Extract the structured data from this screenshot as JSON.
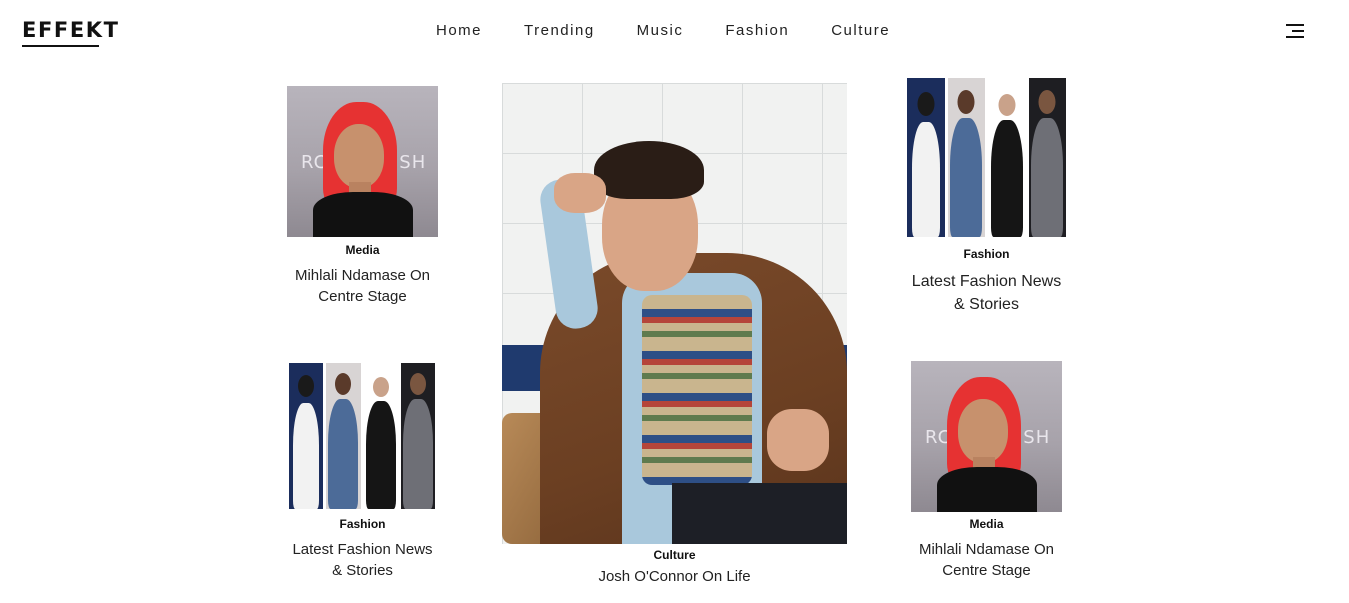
{
  "brand": {
    "logo": "EFFEKT"
  },
  "nav": {
    "items": [
      {
        "label": "Home"
      },
      {
        "label": "Trending"
      },
      {
        "label": "Music"
      },
      {
        "label": "Fashion"
      },
      {
        "label": "Culture"
      }
    ],
    "menu_icon": "hamburger-menu-icon"
  },
  "cards": {
    "left_top": {
      "category": "Media",
      "title_line1": "Mihlali Ndamase On",
      "title_line2": "Centre Stage",
      "watermark_left": "RC",
      "watermark_right": "JSH"
    },
    "left_bottom": {
      "category": "Fashion",
      "title_line1": "Latest Fashion News",
      "title_line2": "& Stories"
    },
    "center": {
      "category": "Culture",
      "title": "Josh O'Connor On Life"
    },
    "right_top": {
      "category": "Fashion",
      "title_line1": "Latest Fashion News",
      "title_line2": "& Stories"
    },
    "right_bottom": {
      "category": "Media",
      "title_line1": "Mihlali Ndamase On",
      "title_line2": "Centre Stage",
      "watermark_left": "RC",
      "watermark_right": "JSH"
    }
  },
  "colors": {
    "text": "#111111",
    "background": "#ffffff",
    "hair_red": "#e63232"
  }
}
